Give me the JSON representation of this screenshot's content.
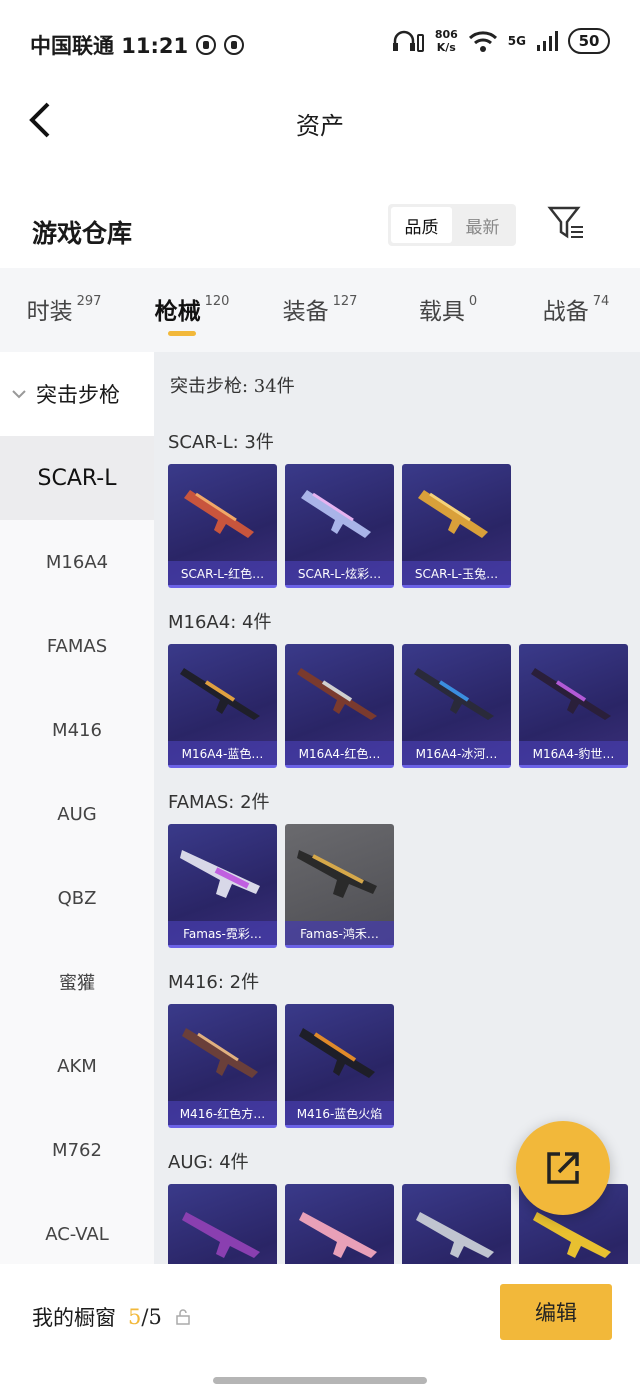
{
  "status": {
    "time_text": "中国联通 11:21",
    "net_speed": "806",
    "net_unit": "K/s",
    "signal": "5G",
    "battery": "50"
  },
  "header": {
    "title": "资产",
    "back_icon": "chevron-left-icon"
  },
  "section": {
    "title": "游戏仓库",
    "sort_options": [
      "品质",
      "最新"
    ],
    "sort_selected": "品质",
    "filter_icon": "filter-icon"
  },
  "categories": [
    {
      "label": "时装",
      "count": "297"
    },
    {
      "label": "枪械",
      "count": "120"
    },
    {
      "label": "装备",
      "count": "127"
    },
    {
      "label": "载具",
      "count": "0"
    },
    {
      "label": "战备",
      "count": "74"
    }
  ],
  "sidebar": {
    "group": "突击步枪",
    "items": [
      "SCAR-L",
      "M16A4",
      "FAMAS",
      "M416",
      "AUG",
      "QBZ",
      "蜜獾",
      "AKM",
      "M762",
      "AC-VAL"
    ]
  },
  "content": {
    "total": "突击步枪: 34件",
    "groups": [
      {
        "title": "SCAR-L: 3件",
        "items": [
          "SCAR-L-红色…",
          "SCAR-L-炫彩…",
          "SCAR-L-玉兔…"
        ]
      },
      {
        "title": "M16A4: 4件",
        "items": [
          "M16A4-蓝色…",
          "M16A4-红色…",
          "M16A4-冰河…",
          "M16A4-豹世…"
        ]
      },
      {
        "title": "FAMAS: 2件",
        "items": [
          "Famas-霓彩…",
          "Famas-鸿禾…"
        ]
      },
      {
        "title": "M416: 2件",
        "items": [
          "M416-红色方…",
          "M416-蓝色火焰"
        ]
      },
      {
        "title": "AUG: 4件",
        "items": [
          "",
          "",
          "",
          ""
        ]
      }
    ]
  },
  "bottom": {
    "showcase_label": "我的橱窗",
    "current": "5",
    "max": "/5",
    "edit_label": "编辑",
    "lock_icon": "lock-icon"
  },
  "fab_icon": "share-external-icon",
  "colors": {
    "accent": "#f2b83a",
    "card_bg": "#2a2566",
    "card_caption": "#463caa"
  }
}
